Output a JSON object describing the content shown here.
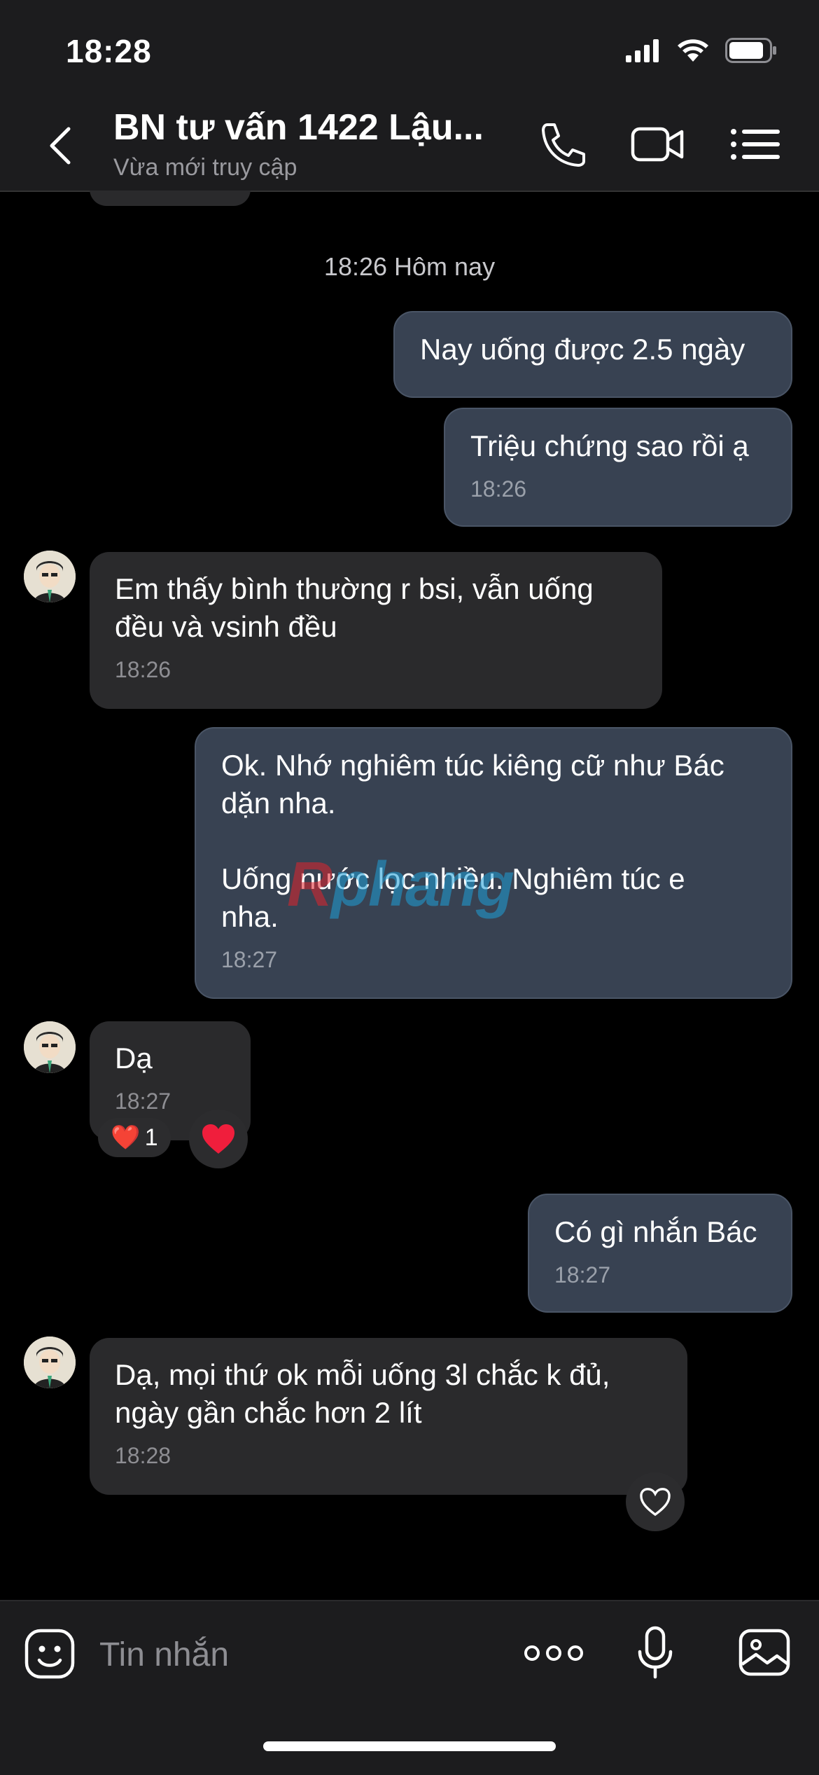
{
  "status": {
    "time": "18:28"
  },
  "header": {
    "title": "BN tư vấn 1422 Lậu...",
    "subtitle": "Vừa mới truy cập"
  },
  "chat": {
    "date_separator": "18:26 Hôm nay",
    "messages": [
      {
        "direction": "out",
        "text": "Nay uống được 2.5 ngày",
        "time": ""
      },
      {
        "direction": "out",
        "text": "Triệu chứng sao rồi ạ",
        "time": "18:26"
      },
      {
        "direction": "in",
        "text": "Em thấy bình thường r bsi, vẫn uống\nđều và vsinh đều",
        "time": "18:26"
      },
      {
        "direction": "out",
        "text": "Ok. Nhớ nghiêm túc kiêng cữ như Bác\ndặn nha.\n\nUống nước lọc nhiều. Nghiêm túc e\nnha.",
        "time": "18:27"
      },
      {
        "direction": "in",
        "text": "Dạ",
        "time": "18:27",
        "reaction": {
          "emoji": "❤️",
          "count": "1"
        }
      },
      {
        "direction": "out",
        "text": "Có gì nhắn Bác",
        "time": "18:27"
      },
      {
        "direction": "in",
        "text": "Dạ, mọi thứ ok mỗi uống 3l chắc k đủ,\nngày gần chắc hơn 2 lít",
        "time": "18:28"
      }
    ]
  },
  "watermark": {
    "r": "R",
    "rest": "phang"
  },
  "composer": {
    "placeholder": "Tin nhắn"
  }
}
